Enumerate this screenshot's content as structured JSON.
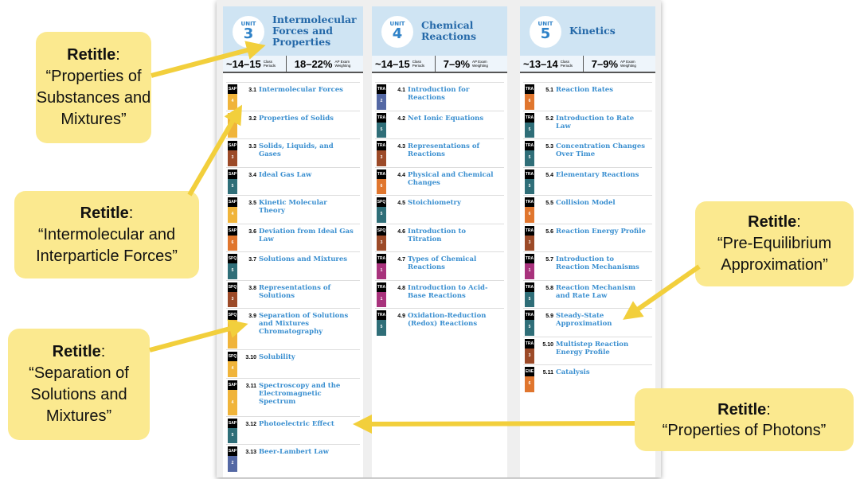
{
  "level_colors": {
    "1": "#a8327c",
    "2": "#5468a4",
    "3": "#9c4a28",
    "4": "#f0b43a",
    "5": "#2f6e78",
    "6": "#e0762e"
  },
  "units": [
    {
      "unit_label": "UNIT",
      "number": "3",
      "title": "Intermolecular Forces and Properties",
      "periods": "~14–15",
      "periods_label": "Class Periods",
      "weight": "18–22%",
      "weight_label": "AP Exam Weighting",
      "topics": [
        {
          "skill": "SAP",
          "level": "4",
          "num": "3.1",
          "name": "Intermolecular Forces"
        },
        {
          "skill": "",
          "level": "",
          "num": "3.2",
          "name": "Properties of Solids"
        },
        {
          "skill": "SAP",
          "level": "3",
          "num": "3.3",
          "name": "Solids, Liquids, and Gases"
        },
        {
          "skill": "SAP",
          "level": "5",
          "num": "3.4",
          "name": "Ideal Gas Law"
        },
        {
          "skill": "SAP",
          "level": "4",
          "num": "3.5",
          "name": "Kinetic Molecular Theory"
        },
        {
          "skill": "SAP",
          "level": "6",
          "num": "3.6",
          "name": "Deviation from Ideal Gas Law"
        },
        {
          "skill": "SPQ",
          "level": "5",
          "num": "3.7",
          "name": "Solutions and Mixtures"
        },
        {
          "skill": "SPQ",
          "level": "3",
          "num": "3.8",
          "name": "Representations of Solutions"
        },
        {
          "skill": "SPQ",
          "level": "",
          "num": "3.9",
          "name": "Separation of Solutions and Mixtures Chromatography"
        },
        {
          "skill": "SPQ",
          "level": "4",
          "num": "3.10",
          "name": "Solubility"
        },
        {
          "skill": "SAP",
          "level": "4",
          "num": "3.11",
          "name": "Spectroscopy and the Electromagnetic Spectrum"
        },
        {
          "skill": "SAP",
          "level": "5",
          "num": "3.12",
          "name": "Photoelectric Effect"
        },
        {
          "skill": "SAP",
          "level": "2",
          "num": "3.13",
          "name": "Beer-Lambert Law"
        }
      ]
    },
    {
      "unit_label": "UNIT",
      "number": "4",
      "title": "Chemical Reactions",
      "periods": "~14–15",
      "periods_label": "Class Periods",
      "weight": "7–9%",
      "weight_label": "AP Exam Weighting",
      "topics": [
        {
          "skill": "TRA",
          "level": "2",
          "num": "4.1",
          "name": "Introduction for Reactions"
        },
        {
          "skill": "TRA",
          "level": "5",
          "num": "4.2",
          "name": "Net Ionic Equations"
        },
        {
          "skill": "TRA",
          "level": "3",
          "num": "4.3",
          "name": "Representations of Reactions"
        },
        {
          "skill": "TRA",
          "level": "6",
          "num": "4.4",
          "name": "Physical and Chemical Changes"
        },
        {
          "skill": "SPQ",
          "level": "5",
          "num": "4.5",
          "name": "Stoichiometry"
        },
        {
          "skill": "SPQ",
          "level": "3",
          "num": "4.6",
          "name": "Introduction to Titration"
        },
        {
          "skill": "TRA",
          "level": "1",
          "num": "4.7",
          "name": "Types of Chemical Reactions"
        },
        {
          "skill": "TRA",
          "level": "1",
          "num": "4.8",
          "name": "Introduction to Acid-Base Reactions"
        },
        {
          "skill": "TRA",
          "level": "5",
          "num": "4.9",
          "name": "Oxidation-Reduction (Redox) Reactions"
        }
      ]
    },
    {
      "unit_label": "UNIT",
      "number": "5",
      "title": "Kinetics",
      "periods": "~13–14",
      "periods_label": "Class Periods",
      "weight": "7–9%",
      "weight_label": "AP Exam Weighting",
      "topics": [
        {
          "skill": "TRA",
          "level": "6",
          "num": "5.1",
          "name": "Reaction Rates"
        },
        {
          "skill": "TRA",
          "level": "5",
          "num": "5.2",
          "name": "Introduction to Rate Law"
        },
        {
          "skill": "TRA",
          "level": "5",
          "num": "5.3",
          "name": "Concentration Changes Over Time"
        },
        {
          "skill": "TRA",
          "level": "5",
          "num": "5.4",
          "name": "Elementary Reactions"
        },
        {
          "skill": "TRA",
          "level": "6",
          "num": "5.5",
          "name": "Collision Model"
        },
        {
          "skill": "TRA",
          "level": "3",
          "num": "5.6",
          "name": "Reaction Energy Profile"
        },
        {
          "skill": "TRA",
          "level": "1",
          "num": "5.7",
          "name": "Introduction to Reaction Mechanisms"
        },
        {
          "skill": "TRA",
          "level": "5",
          "num": "5.8",
          "name": "Reaction Mechanism and Rate Law"
        },
        {
          "skill": "TRA",
          "level": "5",
          "num": "5.9",
          "name": "Steady-State Approximation"
        },
        {
          "skill": "TRA",
          "level": "3",
          "num": "5.10",
          "name": "Multistep Reaction Energy Profile"
        },
        {
          "skill": "ENE",
          "level": "6",
          "num": "5.11",
          "name": "Catalysis"
        }
      ]
    }
  ],
  "callouts": [
    {
      "label": "Retitle",
      "text": "“Properties of Substances and Mixtures”"
    },
    {
      "label": "Retitle",
      "text": "“Intermolecular and Interparticle Forces”"
    },
    {
      "label": "Retitle",
      "text": "“Separation of Solutions and Mixtures”"
    },
    {
      "label": "Retitle",
      "text": "“Pre-Equilibrium Approximation”"
    },
    {
      "label": "Retitle",
      "text": "“Properties of Photons”"
    }
  ],
  "arrow_color": "#f2cf3c",
  "callout_color": "#fbe98f"
}
